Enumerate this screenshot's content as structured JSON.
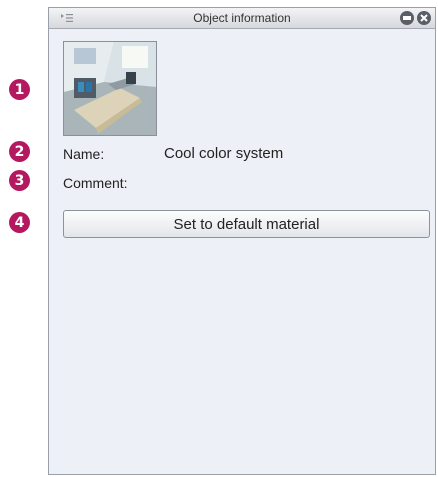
{
  "callouts": [
    "1",
    "2",
    "3",
    "4"
  ],
  "panel": {
    "title": "Object information",
    "menu_icon": "panel-menu-icon",
    "minimize_icon": "minimize-icon",
    "close_icon": "close-icon"
  },
  "object": {
    "thumbnail_icon": "material-thumbnail",
    "name_label": "Name:",
    "name_value": "Cool color system",
    "comment_label": "Comment:",
    "comment_value": ""
  },
  "actions": {
    "default_material_label": "Set to default material"
  },
  "colors": {
    "callout": "#b4195f",
    "panel_bg": "#edf0f6"
  }
}
